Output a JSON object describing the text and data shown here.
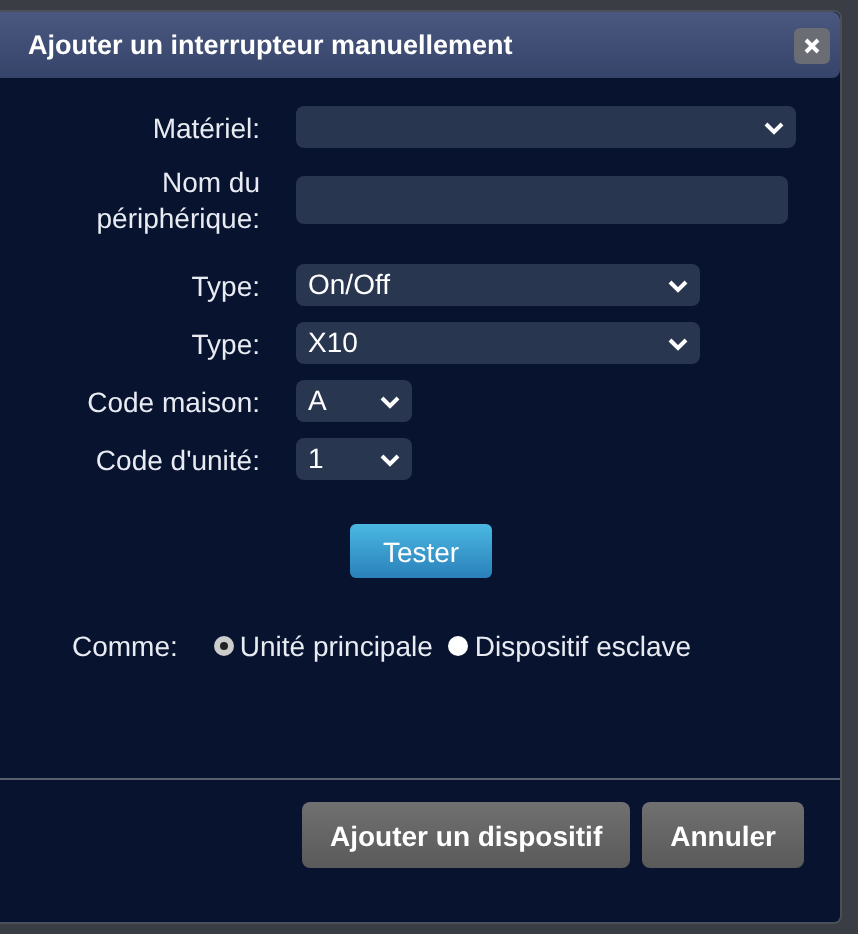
{
  "dialog": {
    "title": "Ajouter un interrupteur manuellement",
    "fields": [
      {
        "kind": "select",
        "label": "Matériel:"
      },
      {
        "kind": "input",
        "label": "Nom du périphérique:"
      },
      {
        "kind": "select",
        "label": "Type:",
        "value": "On/Off"
      },
      {
        "kind": "select",
        "label": "Type:",
        "value": "X10"
      },
      {
        "kind": "select",
        "label": "Code maison:",
        "value": "A"
      },
      {
        "kind": "select",
        "label": "Code d'unité:",
        "value": "1"
      }
    ],
    "test_button": "Tester",
    "as_label": "Comme:",
    "as_options": [
      {
        "label": "Unité principale",
        "selected": true
      },
      {
        "label": "Dispositif esclave",
        "selected": false
      }
    ],
    "buttons": [
      "Ajouter un dispositif",
      "Annuler"
    ]
  }
}
